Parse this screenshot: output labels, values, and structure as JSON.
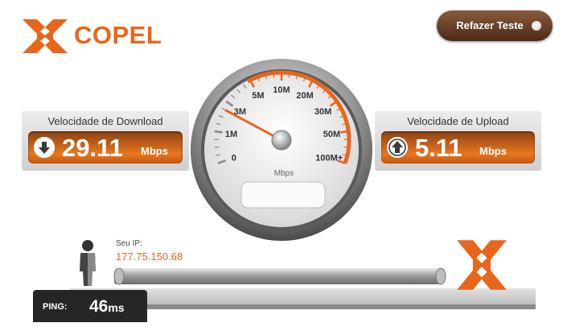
{
  "brand": {
    "name": "COPEL",
    "color": "#e8661c"
  },
  "retest_button": {
    "label": "Refazer Teste"
  },
  "gauge": {
    "ticks": [
      "0",
      "1M",
      "3M",
      "5M",
      "10M",
      "20M",
      "30M",
      "50M",
      "100M+"
    ],
    "unit": "Mbps",
    "needle_value_mbps": 2.5,
    "accent_color": "#e8661c"
  },
  "download": {
    "title": "Velocidade de Download",
    "value": "29.11",
    "unit": "Mbps"
  },
  "upload": {
    "title": "Velocidade de Upload",
    "value": "5.11",
    "unit": "Mbps"
  },
  "ip": {
    "label": "Seu IP:",
    "value": "177.75.150.68"
  },
  "ping": {
    "label": "PING:",
    "value": "46",
    "unit": "ms"
  }
}
